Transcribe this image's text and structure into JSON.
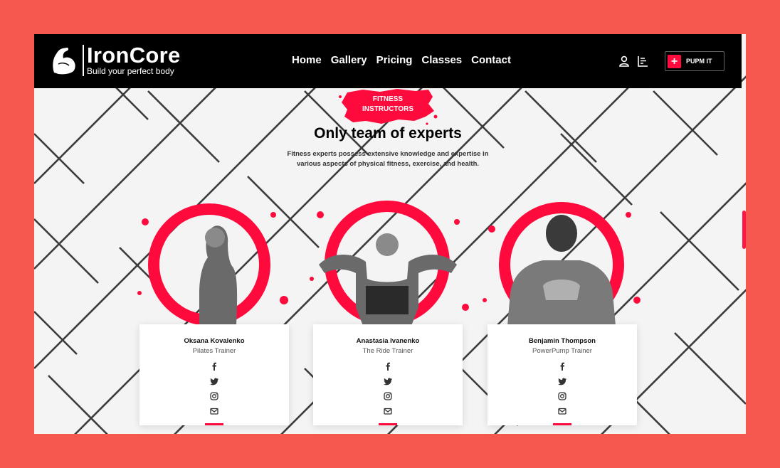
{
  "brand": {
    "name": "IronCore",
    "tagline": "Build your perfect body"
  },
  "nav": [
    "Home",
    "Gallery",
    "Pricing",
    "Classes",
    "Contact"
  ],
  "nav_icons": [
    "user-icon",
    "chart-icon"
  ],
  "cta": {
    "icon": "plus-icon",
    "label": "PUPM IT"
  },
  "section": {
    "badge": [
      "FITNESS",
      "INSTRUCTORS"
    ],
    "title": "Only team of experts",
    "description": "Fitness experts possess extensive knowledge and expertise in various aspects of physical fitness, exercise, and health."
  },
  "trainers": [
    {
      "name": "Oksana Kovalenko",
      "role": "Pilates Trainer"
    },
    {
      "name": "Anastasia Ivanenko",
      "role": "The Ride Trainer"
    },
    {
      "name": "Benjamin Thompson",
      "role": "PowerPump Trainer"
    }
  ],
  "social_icons": [
    "facebook-icon",
    "twitter-icon",
    "instagram-icon",
    "email-icon"
  ],
  "colors": {
    "accent": "#ff0a3c",
    "page_bg": "#f6584f",
    "nav_bg": "#000000"
  }
}
